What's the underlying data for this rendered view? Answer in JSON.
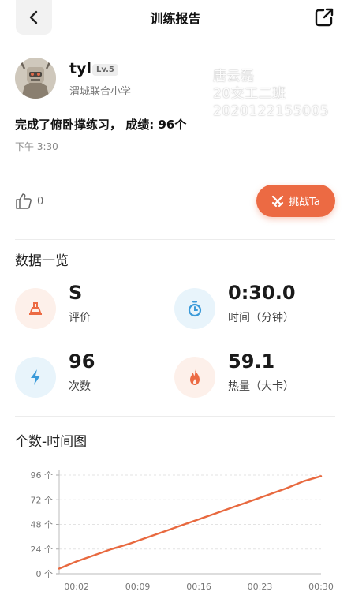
{
  "header": {
    "title": "训练报告",
    "back_icon": "chevron-left-icon",
    "share_icon": "external-share-icon"
  },
  "user": {
    "name": "tyl",
    "level": "Lv.5",
    "school": "渭城联合小学"
  },
  "watermark": {
    "line1": "唐云磊",
    "line2": "20交工二班",
    "line3": "2020122155005"
  },
  "record": {
    "result": "完成了俯卧撑练习， 成绩: 96个",
    "time": "下午 3:30"
  },
  "social": {
    "likes": "0",
    "challenge_label": "挑战Ta"
  },
  "overview": {
    "title": "数据一览",
    "stats": [
      {
        "value": "S",
        "label": "评价",
        "icon": "podium-icon",
        "color": "#ec6a43",
        "bg": "#fdf0ea"
      },
      {
        "value": "0:30.0",
        "label": "时间（分钟）",
        "icon": "stopwatch-icon",
        "color": "#3a9ad9",
        "bg": "#e8f4fb"
      },
      {
        "value": "96",
        "label": "次数",
        "icon": "lightning-icon",
        "color": "#3a9ad9",
        "bg": "#e8f4fb"
      },
      {
        "value": "59.1",
        "label": "热量（大卡）",
        "icon": "flame-icon",
        "color": "#ec6a43",
        "bg": "#fdf0ea"
      }
    ]
  },
  "chart_section": {
    "title": "个数-时间图"
  },
  "chart_data": {
    "type": "line",
    "title": "个数-时间图",
    "x_tick_labels": [
      "00:02",
      "00:09",
      "00:16",
      "00:23",
      "00:30"
    ],
    "y_tick_labels": [
      "0 个",
      "24 个",
      "48 个",
      "72 个",
      "96 个"
    ],
    "x_unit": "seconds",
    "xlim": [
      0,
      30
    ],
    "ylim": [
      0,
      96
    ],
    "x": [
      0,
      2,
      4,
      6,
      8,
      10,
      12,
      14,
      16,
      18,
      20,
      22,
      24,
      26,
      28,
      30
    ],
    "y": [
      5,
      12,
      18,
      24,
      29,
      35,
      41,
      47,
      53,
      59,
      65,
      71,
      77,
      83,
      90,
      95
    ],
    "series_color": "#e8693f",
    "grid": true
  }
}
